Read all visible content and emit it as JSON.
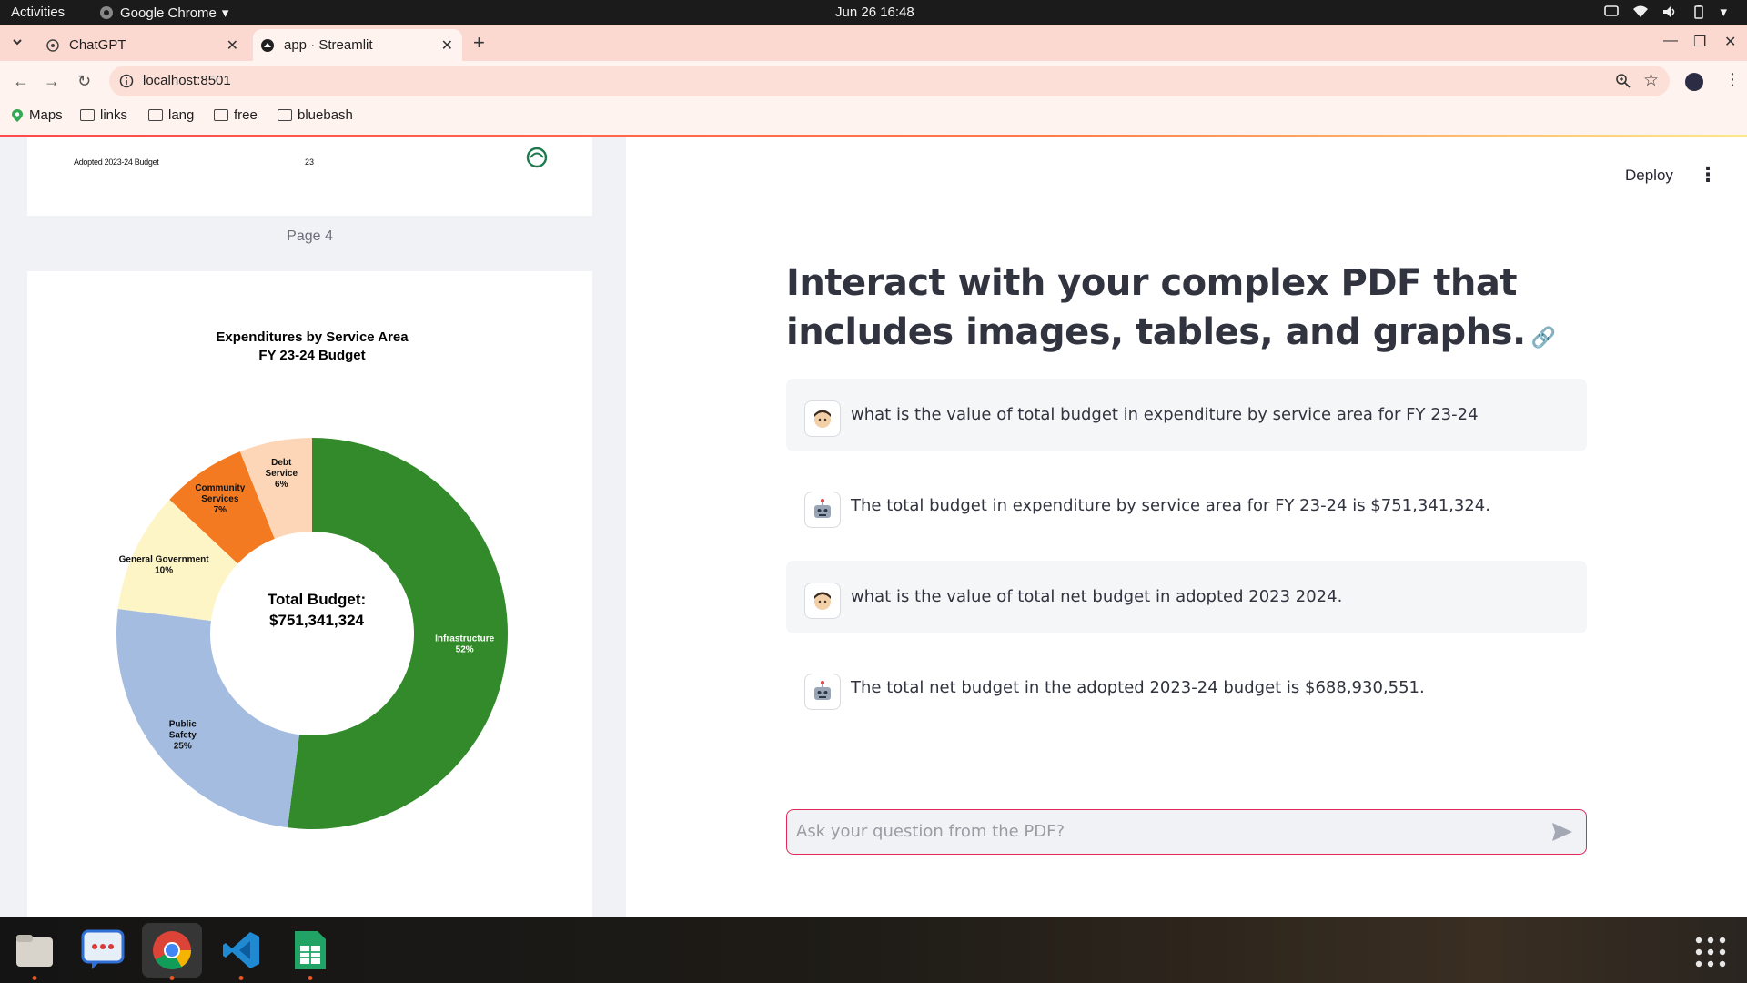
{
  "system": {
    "activities": "Activities",
    "app_name": "Google Chrome",
    "clock": "Jun 26  16:48"
  },
  "browser": {
    "tabs": [
      {
        "label": "ChatGPT"
      },
      {
        "label": "app · Streamlit"
      }
    ],
    "url": "localhost:8501",
    "bookmarks": [
      "Maps",
      "links",
      "lang",
      "free",
      "bluebash"
    ]
  },
  "pdf": {
    "prev_page_footer_left": "Adopted 2023-24 Budget",
    "prev_page_footer_num": "23",
    "page_label": "Page 4"
  },
  "chart_data": {
    "type": "pie",
    "title_line1": "Expenditures by Service Area",
    "title_line2": "FY 23-24 Budget",
    "center_line1": "Total Budget:",
    "center_line2": "$751,341,324",
    "slices": [
      {
        "label": "Infrastructure",
        "value": 52,
        "pct_label": "52%",
        "color": "#338a2a"
      },
      {
        "label": "Public Safety",
        "value": 25,
        "pct_label": "25%",
        "color": "#a4bce0"
      },
      {
        "label": "General Government",
        "value": 10,
        "pct_label": "10%",
        "color": "#fdf5c6"
      },
      {
        "label": "Community Services",
        "value": 7,
        "pct_label": "7%",
        "color": "#f47a22"
      },
      {
        "label": "Debt Service",
        "value": 6,
        "pct_label": "6%",
        "color": "#fcd6b6"
      }
    ]
  },
  "header": {
    "deploy_label": "Deploy"
  },
  "main": {
    "title": "Interact with your complex PDF that includes images, tables, and graphs.",
    "messages": [
      {
        "role": "user",
        "text": "what is the value of total budget in expenditure by service area for FY 23-24"
      },
      {
        "role": "assistant",
        "text": "The total budget in expenditure by service area for FY 23-24 is $751,341,324."
      },
      {
        "role": "user",
        "text": "what is the value of total net budget in adopted 2023 2024."
      },
      {
        "role": "assistant",
        "text": "The total net budget in the adopted 2023-24 budget is $688,930,551."
      }
    ],
    "input_placeholder": "Ask your question from the PDF?"
  },
  "theme": {
    "accent": "#ff4b4b",
    "input_border": "#e3285a",
    "tabstrip_bg": "#fcd9d0"
  }
}
